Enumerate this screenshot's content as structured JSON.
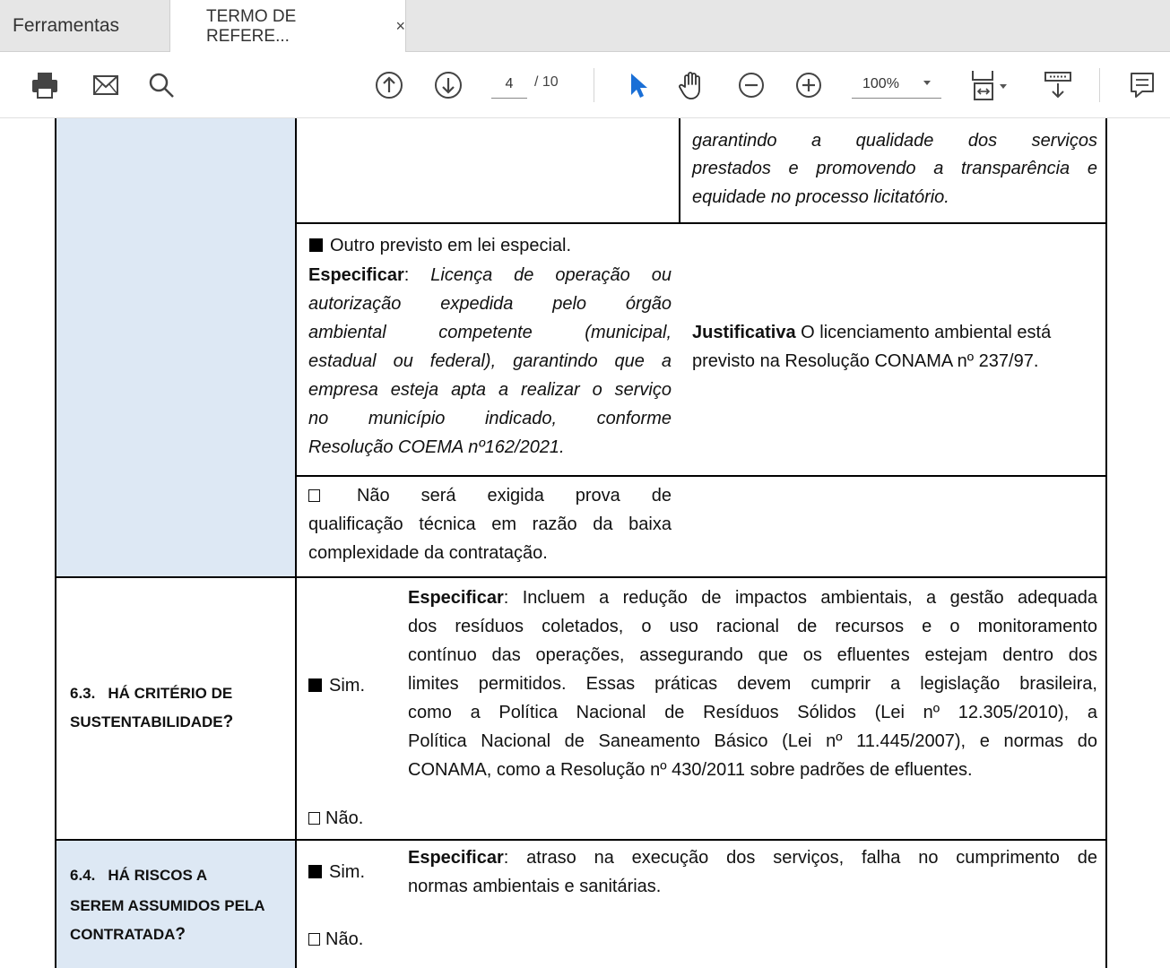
{
  "tabs": {
    "tools_label": "Ferramentas",
    "document_label": "TERMO DE REFERE...",
    "close_symbol": "×"
  },
  "toolbar": {
    "page_current": "4",
    "page_total": "/ 10",
    "zoom": "100%",
    "icons": [
      "print-icon",
      "email-icon",
      "search-icon",
      "page-up-icon",
      "page-down-icon",
      "select-cursor-icon",
      "hand-tool-icon",
      "zoom-out-icon",
      "zoom-in-icon",
      "fit-page-icon",
      "read-mode-icon",
      "comment-icon"
    ],
    "accent_color": "#1a6fd6"
  },
  "document": {
    "shade_color": "#dde8f4",
    "row_top_cont": {
      "lines": [
        "garantindo a qualidade dos serviços",
        "prestados e promovendo a transparência e",
        "equidade no processo licitatório."
      ]
    },
    "row_especial": {
      "option_label": "Outro previsto em lei especial.",
      "spec_label": "Especificar",
      "spec_lines": [
        "Licença de operação ou",
        "autorização expedida pelo órgão",
        "ambiental competente (municipal,",
        "estadual ou federal), garantindo que a",
        "empresa esteja apta a realizar o serviço",
        "no município indicado, conforme",
        "Resolução COEMA nº162/2021."
      ],
      "justification_label": "Justificativa",
      "justification_first": "O licenciamento ambiental está",
      "justification_second": "previsto na Resolução CONAMA nº 237/97."
    },
    "row_nao_exigida": {
      "lines": [
        "Não será exigida prova de",
        "qualificação técnica em razão da baixa",
        "complexidade da contratação."
      ]
    },
    "q63": {
      "number": "6.3.",
      "title_line1": "HÁ CRITÉRIO DE",
      "title_line2": "SUSTENTABILIDADE",
      "qmark": "?",
      "yes_label": "Sim.",
      "no_label": "Não.",
      "spec_label": "Especificar",
      "spec_lines": [
        ": Incluem a redução de impactos ambientais, a gestão adequada",
        "dos resíduos coletados, o uso racional de recursos e o monitoramento",
        "contínuo das operações, assegurando que os efluentes estejam dentro dos",
        "limites permitidos. Essas práticas devem cumprir a legislação brasileira,",
        "como a Política Nacional de Resíduos Sólidos (Lei nº 12.305/2010), a",
        "Política Nacional de Saneamento Básico (Lei nº 11.445/2007), e normas do",
        "CONAMA, como a Resolução nº 430/2011 sobre padrões de efluentes."
      ]
    },
    "q64": {
      "number": "6.4.",
      "title_line1": "HÁ RISCOS A",
      "title_line2": "SEREM ASSUMIDOS PELA",
      "title_line3": "CONTRATADA",
      "qmark": "?",
      "yes_label": "Sim.",
      "no_label": "Não.",
      "spec_label": "Especificar",
      "spec_lines": [
        ": atraso na execução dos serviços, falha no cumprimento de",
        "normas ambientais e sanitárias."
      ]
    }
  }
}
